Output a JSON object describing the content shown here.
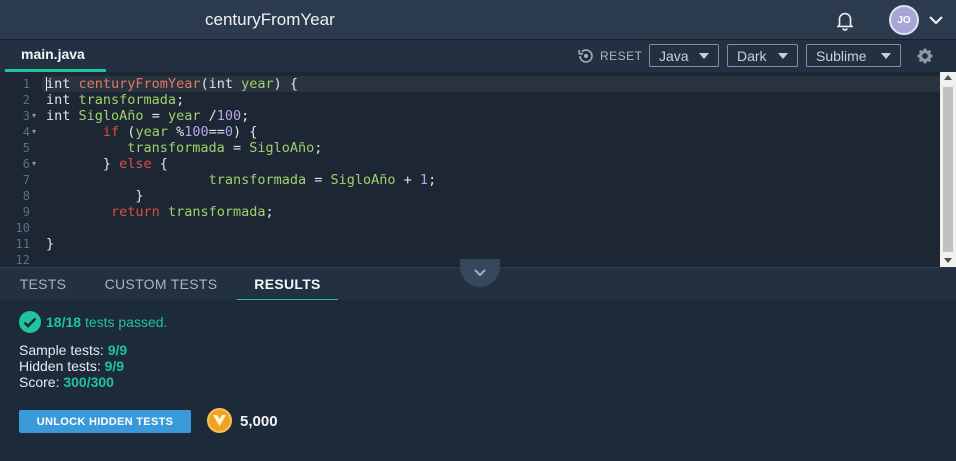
{
  "header": {
    "title": "centuryFromYear",
    "avatar_initials": "JO"
  },
  "editor_bar": {
    "file_tab": "main.java",
    "reset_label": "RESET",
    "language": "Java",
    "theme": "Dark",
    "keymap": "Sublime"
  },
  "code": {
    "lines": [
      {
        "n": "1",
        "fold": false
      },
      {
        "n": "2",
        "fold": false
      },
      {
        "n": "3",
        "fold": true
      },
      {
        "n": "4",
        "fold": true
      },
      {
        "n": "5",
        "fold": false
      },
      {
        "n": "6",
        "fold": true
      },
      {
        "n": "7",
        "fold": false
      },
      {
        "n": "8",
        "fold": false
      },
      {
        "n": "9",
        "fold": false
      },
      {
        "n": "10",
        "fold": false
      },
      {
        "n": "11",
        "fold": false
      },
      {
        "n": "12",
        "fold": false
      }
    ],
    "t": {
      "int": "int",
      "fn_name": "centuryFromYear",
      "year": "year",
      "transformada": "transformada",
      "siglo": "SigloAño",
      "if": "if",
      "else": "else",
      "return": "return",
      "n100": "100",
      "n0": "0",
      "n1": "1"
    }
  },
  "bottom_tabs": {
    "tests": "TESTS",
    "custom_tests": "CUSTOM TESTS",
    "results": "RESULTS"
  },
  "results": {
    "passed_count": "18/18",
    "passed_text": "tests passed.",
    "sample_label": "Sample tests:",
    "sample_value": "9/9",
    "hidden_label": "Hidden tests:",
    "hidden_value": "9/9",
    "score_label": "Score:",
    "score_value": "300/300",
    "unlock_label": "UNLOCK HIDDEN TESTS",
    "coins": "5,000"
  },
  "colors": {
    "accent_green": "#1fc49a",
    "button_blue": "#3a9ad9",
    "coin_orange": "#f0a323"
  }
}
